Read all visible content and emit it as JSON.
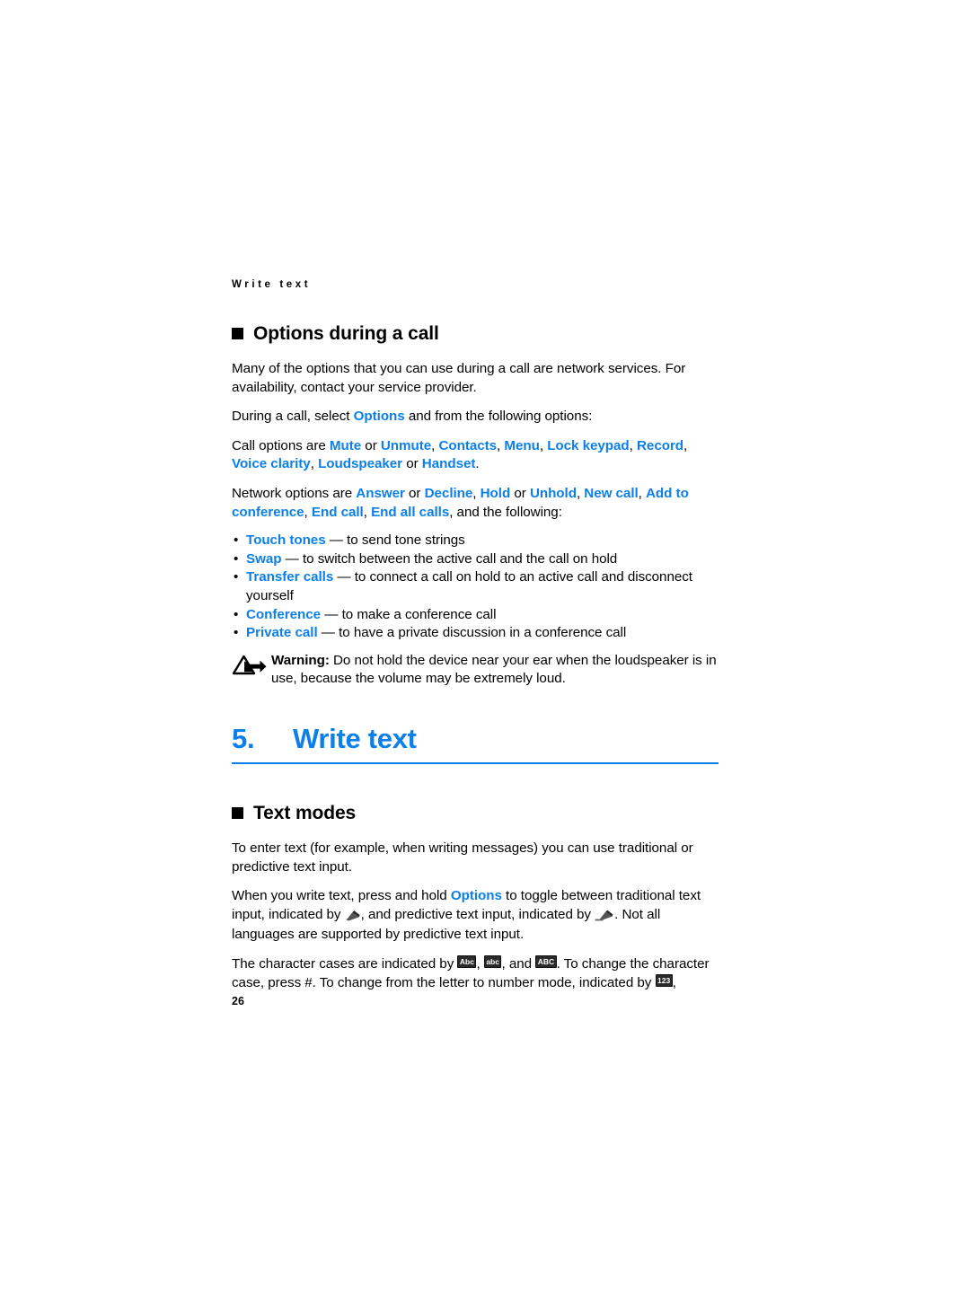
{
  "document": {
    "running_header": "Write text",
    "page_number": "26",
    "accent_color": "#0d7fe8",
    "text_color": "#000000"
  },
  "sections": {
    "options_during_call": {
      "heading": "Options during a call",
      "intro": "Many of the options that you can use during a call are network services. For availability, contact your service provider.",
      "select_prefix": "During a call, select ",
      "select_link": "Options",
      "select_suffix": " and from the following options:",
      "call_options": {
        "prefix": "Call options are ",
        "items": [
          "Mute",
          "Unmute",
          "Contacts",
          "Menu",
          "Lock keypad",
          "Record",
          "Voice clarity",
          "Loudspeaker",
          "Handset"
        ],
        "text": "Call options are Mute or Unmute, Contacts, Menu, Lock keypad, Record, Voice clarity, Loudspeaker or Handset."
      },
      "network_options": {
        "prefix": "Network options are ",
        "items": [
          "Answer",
          "Decline",
          "Hold",
          "Unhold",
          "New call",
          "Add to conference",
          "End call",
          "End all calls"
        ],
        "suffix": ", and the following:",
        "text": "Network options are Answer or Decline, Hold or Unhold, New call, Add to conference, End call, End all calls, and the following:"
      },
      "bullets": [
        {
          "term": "Touch tones",
          "dash": "—",
          "desc": " to send tone strings"
        },
        {
          "term": "Swap",
          "dash": "—",
          "desc": " to switch between the active call and the call on hold"
        },
        {
          "term": "Transfer calls",
          "dash": "—",
          "desc": " to connect a call on hold to an active call and disconnect yourself"
        },
        {
          "term": "Conference",
          "dash": "—",
          "desc": " to make a conference call"
        },
        {
          "term": "Private call",
          "dash": "—",
          "desc": "to have a private discussion in a conference call"
        }
      ],
      "warning": {
        "label": "Warning:",
        "text": " Do not hold the device near your ear when the loudspeaker is in use, because the volume may be extremely loud."
      }
    },
    "chapter": {
      "number": "5.",
      "title": "Write text"
    },
    "text_modes": {
      "heading": "Text modes",
      "para1": "To enter text (for example, when writing messages) you can use traditional or predictive text input.",
      "para2": {
        "part1": "When you write text, press and hold ",
        "link": "Options",
        "part2": " to toggle between traditional text input, indicated by ",
        "part3": ", and predictive text input, indicated by ",
        "part4": ". Not all languages are supported by predictive text input."
      },
      "para3": {
        "part1": "The character cases are indicated by ",
        "case1": "Abc",
        "part2": ", ",
        "case2": "abc",
        "part3": ", and ",
        "case3": "ABC",
        "part4": ". To change the character case, press #. To change from the letter to number mode, indicated by ",
        "case4": "123",
        "part5": ","
      }
    }
  },
  "icons": {
    "warning": "warning-triangle-arrow-icon",
    "traditional_input": "pen-icon",
    "predictive_input": "pen-with-bar-icon",
    "case_upper_first": "abc-badge-icon",
    "case_lower": "abc-lower-badge-icon",
    "case_upper": "ABC-badge-icon",
    "number_mode": "123-badge-icon"
  }
}
